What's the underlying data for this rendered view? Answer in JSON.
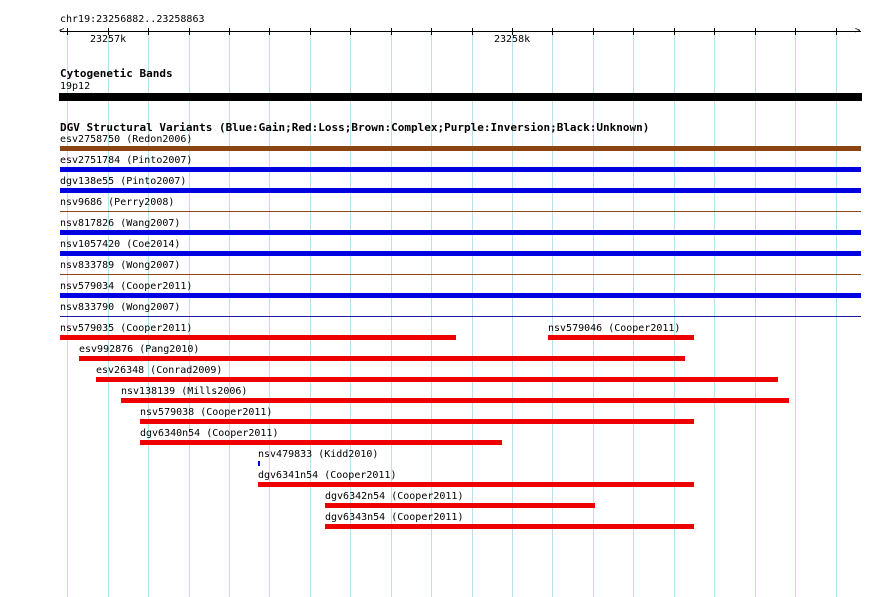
{
  "ruler": {
    "region": "chr19:23256882..23258863",
    "start": 23256882,
    "end": 23258863,
    "major_ticks": [
      {
        "pos": 23257000,
        "label": "23257k"
      },
      {
        "pos": 23258000,
        "label": "23258k"
      }
    ],
    "minor_step": 100
  },
  "cytoband": {
    "title": "Cytogenetic Bands",
    "band": "19p12"
  },
  "dgv": {
    "title": "DGV Structural Variants (Blue:Gain;Red:Loss;Brown:Complex;Purple:Inversion;Black:Unknown)",
    "colors": {
      "gain": "#0000e0",
      "loss": "#ee0000",
      "complex": "#8b4513",
      "thin_brown": "#8b4513",
      "thin_blue": "#1a1aa0"
    },
    "rows": [
      {
        "features": [
          {
            "label": "esv2758750 (Redon2006)",
            "start": 23256882,
            "end": 23258863,
            "type": "complex",
            "height": 5
          }
        ]
      },
      {
        "features": [
          {
            "label": "esv2751784 (Pinto2007)",
            "start": 23256882,
            "end": 23258863,
            "type": "gain",
            "height": 5
          }
        ]
      },
      {
        "features": [
          {
            "label": "dgv138e55 (Pinto2007)",
            "start": 23256882,
            "end": 23258863,
            "type": "gain",
            "height": 5
          }
        ]
      },
      {
        "features": [
          {
            "label": "nsv9686 (Perry2008)",
            "start": 23256882,
            "end": 23258863,
            "type": "thin_brown",
            "height": 1
          }
        ]
      },
      {
        "features": [
          {
            "label": "nsv817826 (Wang2007)",
            "start": 23256882,
            "end": 23258863,
            "type": "gain",
            "height": 5
          }
        ]
      },
      {
        "features": [
          {
            "label": "nsv1057420 (Coe2014)",
            "start": 23256882,
            "end": 23258863,
            "type": "gain",
            "height": 5
          }
        ]
      },
      {
        "features": [
          {
            "label": "nsv833789 (Wong2007)",
            "start": 23256882,
            "end": 23258863,
            "type": "thin_brown",
            "height": 1
          }
        ]
      },
      {
        "features": [
          {
            "label": "nsv579034 (Cooper2011)",
            "start": 23256882,
            "end": 23258863,
            "type": "gain",
            "height": 5
          }
        ]
      },
      {
        "features": [
          {
            "label": "nsv833790 (Wong2007)",
            "start": 23256882,
            "end": 23258863,
            "type": "thin_blue",
            "height": 1
          }
        ]
      },
      {
        "features": [
          {
            "label": "nsv579035 (Cooper2011)",
            "start": 23256882,
            "end": 23257862,
            "type": "loss",
            "height": 5
          },
          {
            "label": "nsv579046 (Cooper2011)",
            "start": 23258090,
            "end": 23258450,
            "type": "loss",
            "height": 5
          }
        ]
      },
      {
        "features": [
          {
            "label": "esv992876 (Pang2010)",
            "start": 23256930,
            "end": 23258428,
            "type": "loss",
            "height": 5
          }
        ]
      },
      {
        "features": [
          {
            "label": "esv26348 (Conrad2009)",
            "start": 23256972,
            "end": 23258658,
            "type": "loss",
            "height": 5
          }
        ]
      },
      {
        "features": [
          {
            "label": "nsv138139 (Mills2006)",
            "start": 23257032,
            "end": 23258683,
            "type": "loss",
            "height": 5
          }
        ]
      },
      {
        "features": [
          {
            "label": "nsv579038 (Cooper2011)",
            "start": 23257080,
            "end": 23258450,
            "type": "loss",
            "height": 5
          }
        ]
      },
      {
        "features": [
          {
            "label": "dgv6340n54 (Cooper2011)",
            "start": 23257080,
            "end": 23257975,
            "type": "loss",
            "height": 5
          }
        ]
      },
      {
        "features": [
          {
            "label": "nsv479833 (Kidd2010)",
            "start": 23257372,
            "end": 23257375,
            "type": "gain",
            "height": 5
          }
        ]
      },
      {
        "features": [
          {
            "label": "dgv6341n54 (Cooper2011)",
            "start": 23257372,
            "end": 23258450,
            "type": "loss",
            "height": 5
          }
        ]
      },
      {
        "features": [
          {
            "label": "dgv6342n54 (Cooper2011)",
            "start": 23257538,
            "end": 23258205,
            "type": "loss",
            "height": 5
          }
        ]
      },
      {
        "features": [
          {
            "label": "dgv6343n54 (Cooper2011)",
            "start": 23257538,
            "end": 23258450,
            "type": "loss",
            "height": 5
          }
        ]
      }
    ]
  }
}
